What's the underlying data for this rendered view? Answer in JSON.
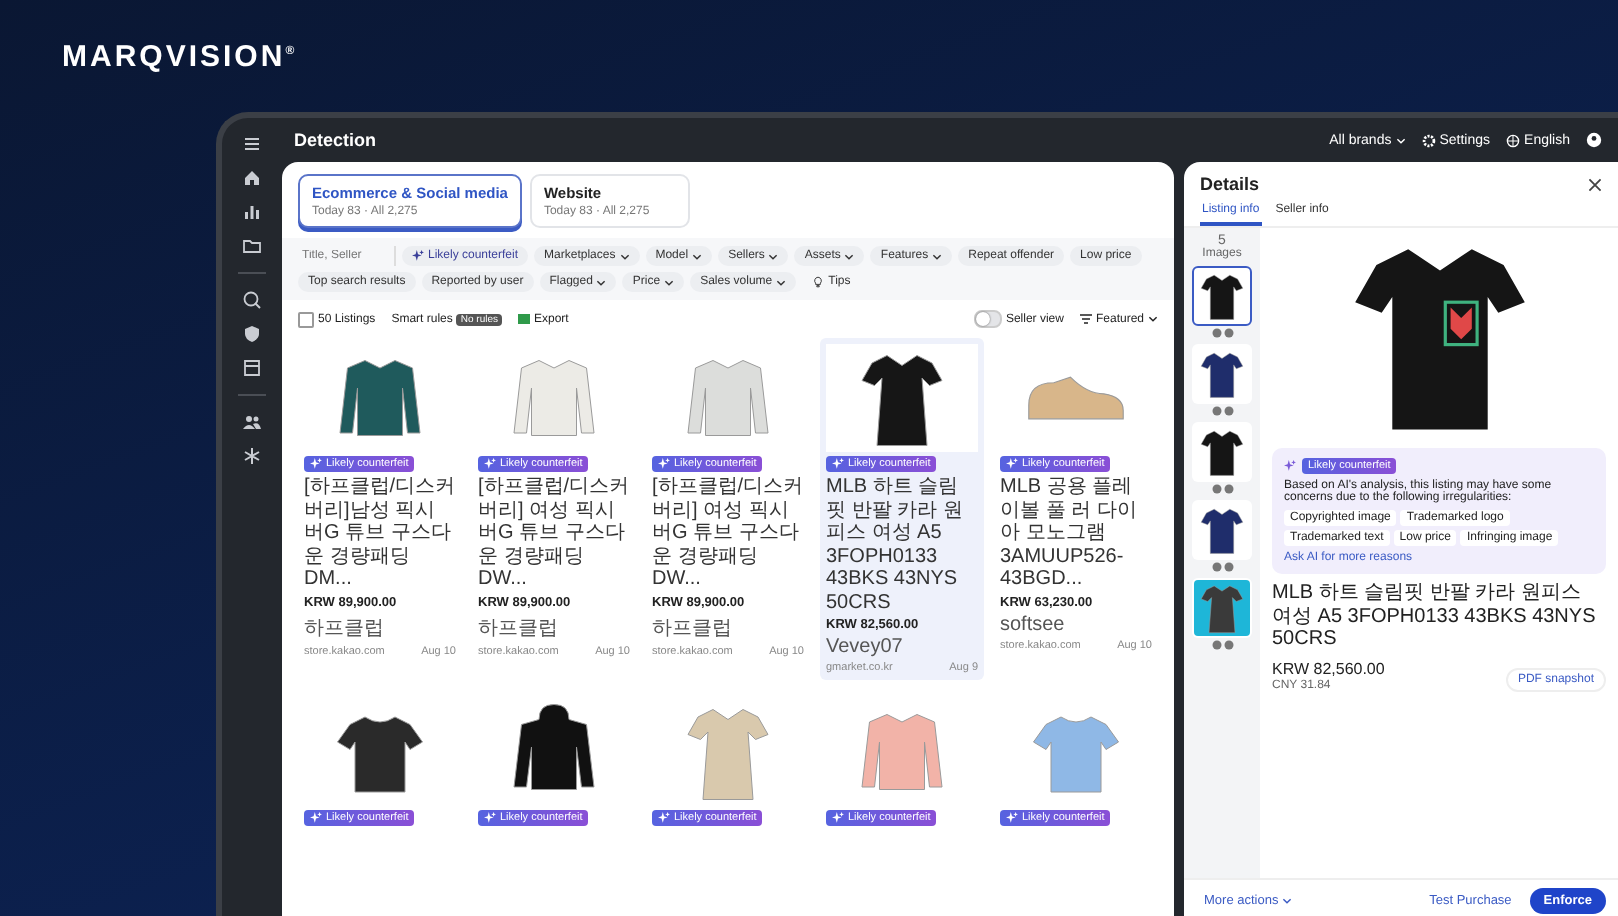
{
  "logo": "MARQVISION$^{®}$",
  "topbar": {
    "title": "Detection",
    "brands": "All brands",
    "settings": "Settings",
    "language": "English"
  },
  "source_tabs": [
    {
      "label": "Ecommerce & Social media",
      "stats": "Today 83 · All 2,275",
      "selected": true
    },
    {
      "label": "Website",
      "stats": "Today 83 · All 2,275",
      "selected": false
    }
  ],
  "search": {
    "placeholder": "Title, Seller"
  },
  "filters": [
    {
      "label": "Likely counterfeit",
      "kind": "ai"
    },
    {
      "label": "Marketplaces",
      "kind": "dropdown"
    },
    {
      "label": "Model",
      "kind": "dropdown"
    },
    {
      "label": "Sellers",
      "kind": "dropdown"
    },
    {
      "label": "Assets",
      "kind": "dropdown"
    },
    {
      "label": "Features",
      "kind": "dropdown"
    },
    {
      "label": "Repeat offender",
      "kind": "plain"
    },
    {
      "label": "Low price",
      "kind": "plain"
    },
    {
      "label": "Top search results",
      "kind": "plain"
    },
    {
      "label": "Reported by user",
      "kind": "plain"
    },
    {
      "label": "Flagged",
      "kind": "dropdown"
    },
    {
      "label": "Price",
      "kind": "dropdown"
    },
    {
      "label": "Sales volume",
      "kind": "dropdown"
    },
    {
      "label": "Tips",
      "kind": "tips"
    }
  ],
  "listing_bar": {
    "select_all": {
      "label": "50 Listings",
      "checked": false
    },
    "smart_rules": "Smart rules",
    "rules_badge": "No rules",
    "export": "Export",
    "seller_view": {
      "label": "Seller view",
      "on": false
    },
    "sort": "Featured"
  },
  "listings": [
    {
      "kind": "jacket",
      "color": "#1f5a5c",
      "badge": "Likely counterfeit",
      "title": "[하프클럽/디스커버리]남성 픽시 버G 튜브 구스다운 경량패딩 DM...",
      "price": "KRW 89,900.00",
      "seller": "하프클럽",
      "store": "store.kakao.com",
      "date": "Aug 10",
      "selected": false
    },
    {
      "kind": "jacket",
      "color": "#ecebe6",
      "badge": "Likely counterfeit",
      "title": "[하프클럽/디스커버리] 여성 픽시 버G 튜브 구스다운 경량패딩 DW...",
      "price": "KRW 89,900.00",
      "seller": "하프클럽",
      "store": "store.kakao.com",
      "date": "Aug 10",
      "selected": false
    },
    {
      "kind": "jacket",
      "color": "#dcdddb",
      "badge": "Likely counterfeit",
      "title": "[하프클럽/디스커버리] 여성 픽시 버G 튜브 구스다운 경량패딩 DW...",
      "price": "KRW 89,900.00",
      "seller": "하프클럽",
      "store": "store.kakao.com",
      "date": "Aug 10",
      "selected": false
    },
    {
      "kind": "dress",
      "color": "#161616",
      "badge": "Likely counterfeit",
      "title": "MLB 하트 슬림핏 반팔 카라 원피스 여성 A5 3FOPH0133 43BKS 43NYS 50CRS",
      "price": "KRW 82,560.00",
      "seller": "Vevey07",
      "store": "gmarket.co.kr",
      "date": "Aug 9",
      "selected": true
    },
    {
      "kind": "shoes",
      "color": "#d8b68a",
      "badge": "Likely counterfeit",
      "title": "MLB 공용 플레이볼 풀 러 다이아 모노그램 3AMUUP526-43BGD...",
      "price": "KRW 63,230.00",
      "seller": "softsee",
      "store": "store.kakao.com",
      "date": "Aug 10",
      "selected": false
    },
    {
      "kind": "tshirt",
      "color": "#2a2a2a",
      "badge": "Likely counterfeit",
      "selected": false
    },
    {
      "kind": "hoodie",
      "color": "#111111",
      "badge": "Likely counterfeit",
      "selected": false
    },
    {
      "kind": "dress",
      "color": "#d9c9ad",
      "badge": "Likely counterfeit",
      "selected": false
    },
    {
      "kind": "jacket",
      "color": "#f2b3a8",
      "badge": "Likely counterfeit",
      "selected": false
    },
    {
      "kind": "tshirt",
      "color": "#8fb8e6",
      "badge": "Likely counterfeit",
      "selected": false
    }
  ],
  "details": {
    "title": "Details",
    "tabs": [
      {
        "label": "Listing info",
        "selected": true
      },
      {
        "label": "Seller info",
        "selected": false
      }
    ],
    "image_count": "5",
    "images_label": "Images",
    "thumbnails": [
      {
        "kind": "polo",
        "color": "#151515",
        "selected": true
      },
      {
        "kind": "polo",
        "color": "#1f2d6b",
        "selected": false
      },
      {
        "kind": "polo",
        "color": "#151515",
        "selected": false
      },
      {
        "kind": "polo",
        "color": "#1f2d6b",
        "selected": false
      },
      {
        "kind": "model_photo",
        "color": "#3a3a3a",
        "selected": false
      }
    ],
    "ai": {
      "badge": "Likely counterfeit",
      "text": "Based on AI's analysis, this listing may have some concerns due to the following irregularities:",
      "reasons": [
        "Copyrighted image",
        "Trademarked logo",
        "Trademarked text",
        "Low price",
        "Infringing image"
      ],
      "link": "Ask AI for more reasons"
    },
    "product_title": "MLB 하트 슬림핏 반팔 카라 원피스 여성 A5 3FOPH0133 43BKS 43NYS 50CRS",
    "price": "KRW 82,560.00",
    "converted": "CNY 31.84",
    "pdf": "PDF snapshot",
    "more_actions": "More actions",
    "test_purchase": "Test Purchase",
    "enforce": "Enforce"
  }
}
